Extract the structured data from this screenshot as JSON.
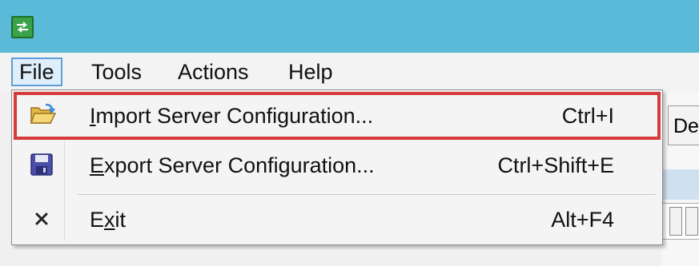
{
  "menubar": {
    "items": [
      {
        "label": "File"
      },
      {
        "label": "Tools"
      },
      {
        "label": "Actions"
      },
      {
        "label": "Help"
      }
    ]
  },
  "file_menu": {
    "items": [
      {
        "label_ul": "I",
        "label_rest": "mport Server Configuration...",
        "shortcut": "Ctrl+I",
        "icon": "open-folder-icon",
        "highlighted": true
      },
      {
        "label_ul": "E",
        "label_rest": "xport Server Configuration...",
        "shortcut": "Ctrl+Shift+E",
        "icon": "save-disk-icon"
      },
      {
        "label_pre": "E",
        "label_ul": "x",
        "label_rest": "it",
        "shortcut": "Alt+F4",
        "icon": "close-x-icon"
      }
    ]
  },
  "background": {
    "button_partial_label": "De"
  },
  "colors": {
    "titlebar": "#5bbad7",
    "highlight_border": "#d63a3a",
    "menu_selected_bg": "#dfeefb"
  }
}
